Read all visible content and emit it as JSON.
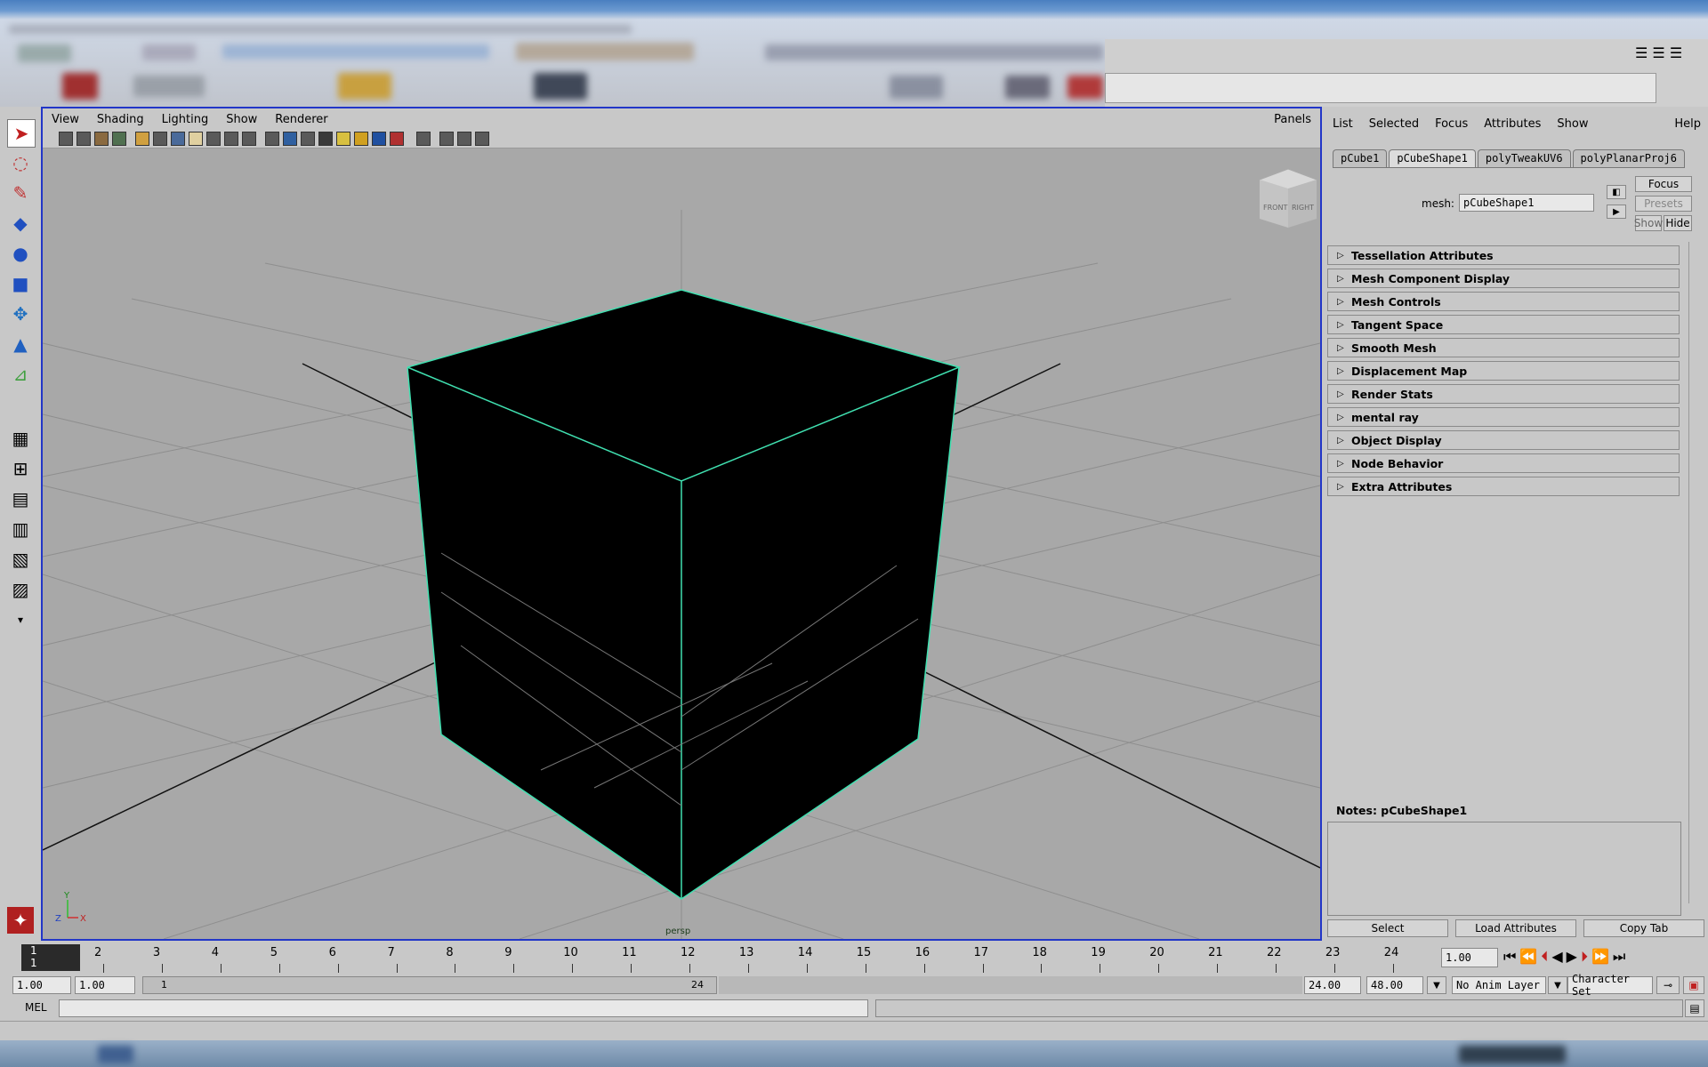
{
  "viewport": {
    "menu": [
      "View",
      "Shading",
      "Lighting",
      "Show",
      "Renderer"
    ],
    "panels_label": "Panels",
    "camera_label": "persp",
    "viewcube": {
      "front": "FRONT",
      "right": "RIGHT"
    },
    "axis": {
      "y": "Y",
      "z": "Z",
      "x": "X"
    }
  },
  "attribute_editor": {
    "menu": [
      "List",
      "Selected",
      "Focus",
      "Attributes",
      "Show"
    ],
    "help_label": "Help",
    "tabs": [
      "pCube1",
      "pCubeShape1",
      "polyTweakUV6",
      "polyPlanarProj6"
    ],
    "active_tab": 1,
    "mesh_label": "mesh:",
    "mesh_value": "pCubeShape1",
    "focus_label": "Focus",
    "presets_label": "Presets",
    "show_label": "Show",
    "hide_label": "Hide",
    "sections": [
      "Tessellation Attributes",
      "Mesh Component Display",
      "Mesh Controls",
      "Tangent Space",
      "Smooth Mesh",
      "Displacement Map",
      "Render Stats",
      "mental ray",
      "Object Display",
      "Node Behavior",
      "Extra Attributes"
    ],
    "notes_label": "Notes:  pCubeShape1",
    "select_label": "Select",
    "load_attributes_label": "Load Attributes",
    "copy_tab_label": "Copy Tab"
  },
  "timeline": {
    "ticks": [
      "1",
      "2",
      "3",
      "4",
      "5",
      "6",
      "7",
      "8",
      "9",
      "10",
      "11",
      "12",
      "13",
      "14",
      "15",
      "16",
      "17",
      "18",
      "19",
      "20",
      "21",
      "22",
      "23",
      "24"
    ],
    "current_frame_top": "1",
    "current_frame_bottom": "1",
    "current_time": "1.00"
  },
  "range": {
    "start_time": "1.00",
    "playback_start": "1.00",
    "range_start": "1",
    "range_end": "24",
    "playback_end": "24.00",
    "end_time": "48.00",
    "anim_layer": "No Anim Layer",
    "character_set": "Character Set"
  },
  "command": {
    "mel_label": "MEL"
  }
}
